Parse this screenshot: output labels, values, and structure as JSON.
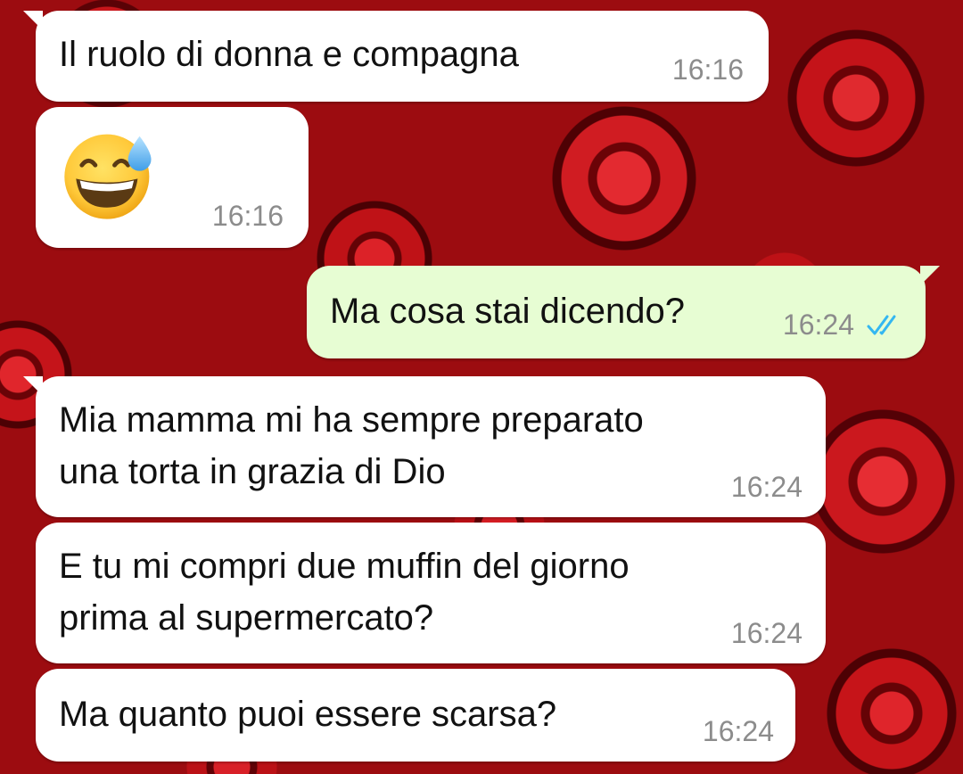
{
  "chat": {
    "messages": [
      {
        "direction": "incoming",
        "text": "Il ruolo di donna e compagna",
        "time": "16:16"
      },
      {
        "direction": "incoming",
        "emoji": "grinning-face-with-sweat",
        "time": "16:16"
      },
      {
        "direction": "outgoing",
        "text": "Ma cosa stai dicendo?",
        "time": "16:24",
        "status": "read"
      },
      {
        "direction": "incoming",
        "text": "Mia mamma mi ha sempre preparato\nuna torta in grazia di Dio",
        "time": "16:24"
      },
      {
        "direction": "incoming",
        "text": "E tu mi compri due muffin del giorno\nprima al supermercato?",
        "time": "16:24"
      },
      {
        "direction": "incoming",
        "text": "Ma quanto puoi essere scarsa?",
        "time": "16:24"
      }
    ]
  },
  "colors": {
    "incoming_bubble": "#ffffff",
    "outgoing_bubble": "#e7fdd3",
    "timestamp": "#8c8c8c",
    "read_ticks": "#34b7f1",
    "background": "#9c0c10"
  },
  "icons": {
    "read_status": "double-check-icon",
    "message_emoji": "grinning-face-with-sweat-emoji"
  }
}
